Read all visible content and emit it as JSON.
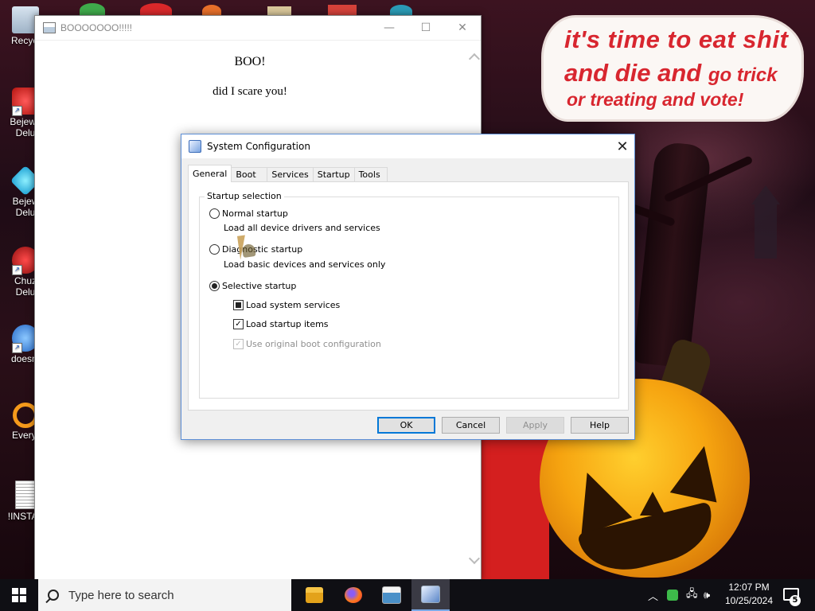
{
  "wallpaper": {
    "bubble_line1": "it's time to eat shit",
    "bubble_line2_big": "and die and",
    "bubble_line2_small": "go trick",
    "bubble_line3": "or treating and vote!",
    "colors": {
      "bubble_text": "#d8262f",
      "bg": "#2a0f18",
      "pumpkin": "#f6a410"
    }
  },
  "desktop_icons": [
    {
      "label": "Recycl",
      "icon": "recycle-bin-icon"
    },
    {
      "label": "Bejewe\nDelu",
      "icon": "bejeweled-icon"
    },
    {
      "label": "Bejew\nDelu",
      "icon": "bejeweled-gem-icon"
    },
    {
      "label": "Chuz\nDelu",
      "icon": "chuzzle-icon"
    },
    {
      "label": "doesnt",
      "icon": "bird-icon"
    },
    {
      "label": "Everyt",
      "icon": "everything-search-icon"
    },
    {
      "label": "!INSTAL",
      "icon": "document-icon"
    }
  ],
  "boo_window": {
    "title": "BOOOOOOO!!!!!",
    "heading": "BOO!",
    "text": "did I scare you!"
  },
  "dialog": {
    "title": "System Configuration",
    "tabs": [
      "General",
      "Boot",
      "Services",
      "Startup",
      "Tools"
    ],
    "active_tab": "General",
    "group_label": "Startup selection",
    "options": [
      {
        "label": "Normal startup",
        "desc": "Load all device drivers and services",
        "checked": false
      },
      {
        "label": "Diagnostic startup",
        "desc": "Load basic devices and services only",
        "checked": false
      },
      {
        "label": "Selective startup",
        "checked": true
      }
    ],
    "checkboxes": [
      {
        "label": "Load system services",
        "state": "indeterminate"
      },
      {
        "label": "Load startup items",
        "state": "checked"
      },
      {
        "label": "Use original boot configuration",
        "state": "checked-disabled"
      }
    ],
    "buttons": {
      "ok": "OK",
      "cancel": "Cancel",
      "apply": "Apply",
      "help": "Help"
    }
  },
  "taskbar": {
    "search_placeholder": "Type here to search",
    "apps": [
      "file-explorer-icon",
      "firefox-icon",
      "notepad-icon",
      "system-configuration-icon"
    ],
    "time": "12:07 PM",
    "date": "10/25/2024",
    "notification_count": "5"
  }
}
